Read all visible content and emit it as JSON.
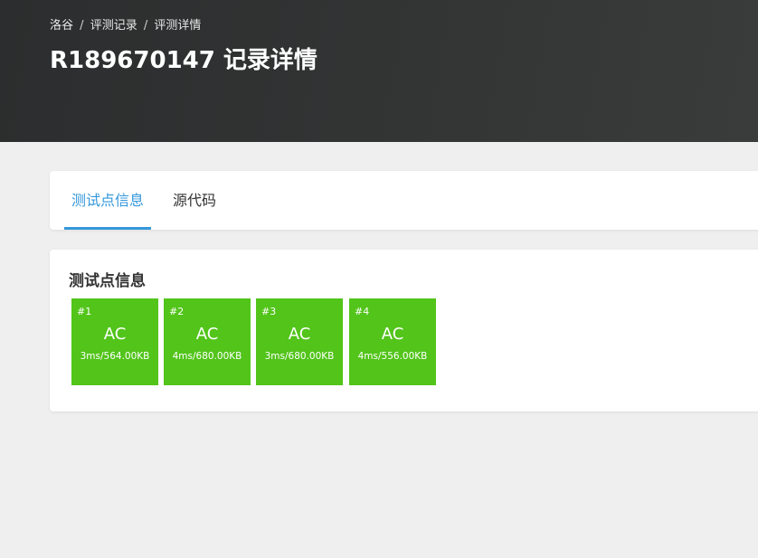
{
  "header": {
    "breadcrumb": [
      "洛谷",
      "评测记录",
      "评测详情"
    ],
    "separator": "/",
    "title": "R189670147 记录详情"
  },
  "tabs": [
    {
      "label": "测试点信息",
      "active": true
    },
    {
      "label": "源代码",
      "active": false
    }
  ],
  "test_section": {
    "title": "测试点信息",
    "status_color": "#52c41a",
    "cases": [
      {
        "id": "#1",
        "status": "AC",
        "detail": "3ms/564.00KB"
      },
      {
        "id": "#2",
        "status": "AC",
        "detail": "4ms/680.00KB"
      },
      {
        "id": "#3",
        "status": "AC",
        "detail": "3ms/680.00KB"
      },
      {
        "id": "#4",
        "status": "AC",
        "detail": "4ms/556.00KB"
      }
    ]
  },
  "colors": {
    "accent": "#3498db",
    "header_bg": "#2f3131",
    "page_bg": "#efefef"
  }
}
